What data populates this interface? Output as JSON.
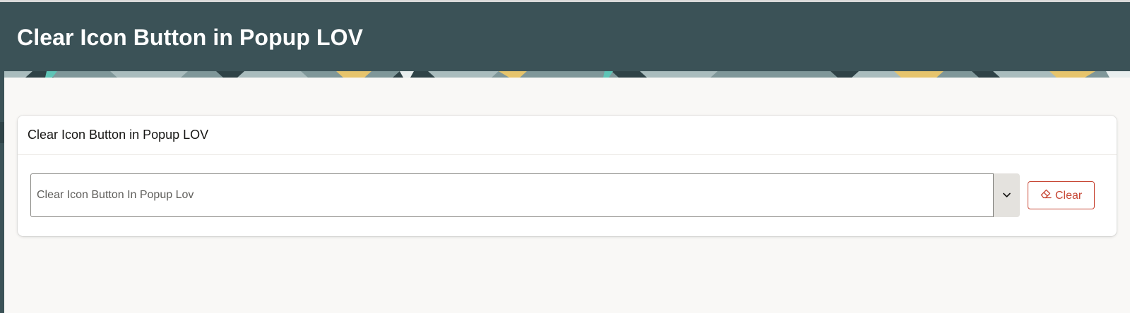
{
  "header": {
    "title": "Clear Icon Button in Popup LOV"
  },
  "region": {
    "title": "Clear Icon Button in Popup LOV",
    "lov": {
      "value": "Clear Icon Button In Popup Lov",
      "button_icon": "chevron-down-icon"
    },
    "clear_button": {
      "label": "Clear",
      "icon": "eraser-icon"
    }
  },
  "colors": {
    "header_bg": "#3b5257",
    "page_bg": "#f9f8f6",
    "accent_red": "#c74634",
    "banner_yellow": "#e6c46c",
    "banner_teal": "#5ec4b6"
  }
}
